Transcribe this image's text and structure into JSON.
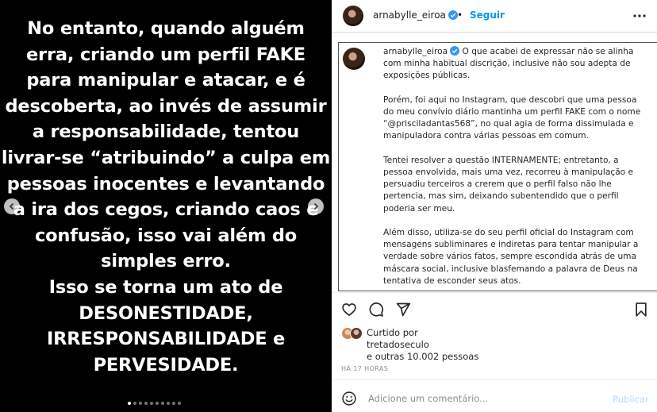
{
  "slide": {
    "lines": [
      "No entanto, quando alguém",
      "erra, criando um perfil FAKE",
      "para manipular e atacar, e é",
      "descoberta, ao invés de assumir",
      "a responsabilidade, tentou",
      "livrar-se “atribuindo” a culpa em",
      "pessoas inocentes e levantando",
      "a ira dos cegos, criando caos e",
      "confusão, isso vai além do",
      "simples erro.",
      "Isso se torna um ato de",
      "DESONESTIDADE,",
      "IRRESPONSABILIDADE e",
      "PERVESIDADE."
    ],
    "dot_count": 10,
    "active_dot": 0
  },
  "header": {
    "username": "arnabylle_eiroa",
    "separator": "•",
    "follow_label": "Seguir"
  },
  "caption": {
    "username": "arnabylle_eiroa",
    "first_line_rest": "O que acabei de expressar não se alinha",
    "para1_lines": [
      "com minha habitual discrição, inclusive não sou adepta de",
      "exposições públicas."
    ],
    "para2_lines": [
      "Porém, foi aqui no Instagram, que descobri que uma pessoa",
      "do meu convívio diário mantinha um perfil FAKE com o nome",
      "“@prisciladantas568”, no qual agia de forma dissimulada e",
      "manipuladora contra várias pessoas em comum."
    ],
    "para3_lines": [
      "Tentei resolver a questão INTERNAMENTE; entretanto, a",
      "pessoa envolvida, mais uma vez, recorreu à manipulação e",
      "persuadiu terceiros a crerem que o perfil falso não lhe",
      "pertencia, mas sim, deixando subentendido que o perfil",
      "poderia ser meu."
    ],
    "para4_lines": [
      "Além disso, utiliza-se do seu perfil oficial do Instagram com",
      "mensagens subliminares e indiretas para tentar manipular a",
      "verdade sobre vários fatos, sempre escondida atrás de uma",
      "máscara social, inclusive blasfemando a palavra de Deus na",
      "tentativa de esconder seus atos."
    ]
  },
  "likes": {
    "line1": "Curtido por",
    "line2": "tretadoseculo",
    "line3": "e outras 10.002 pessoas"
  },
  "timestamp": "HÁ 17 HORAS",
  "comment": {
    "placeholder": "Adicione um comentário...",
    "publish_label": "Publicar"
  },
  "icons": {
    "heart": "heart-icon",
    "comment": "comment-icon",
    "share": "share-icon",
    "save": "bookmark-icon",
    "more": "more-horizontal-icon",
    "emoji": "emoji-icon",
    "verified": "verified-badge-icon"
  },
  "colors": {
    "follow": "#0095f6",
    "verified": "#3897f0",
    "publish_disabled": "#b3dbff",
    "media_bg": "#000000"
  }
}
